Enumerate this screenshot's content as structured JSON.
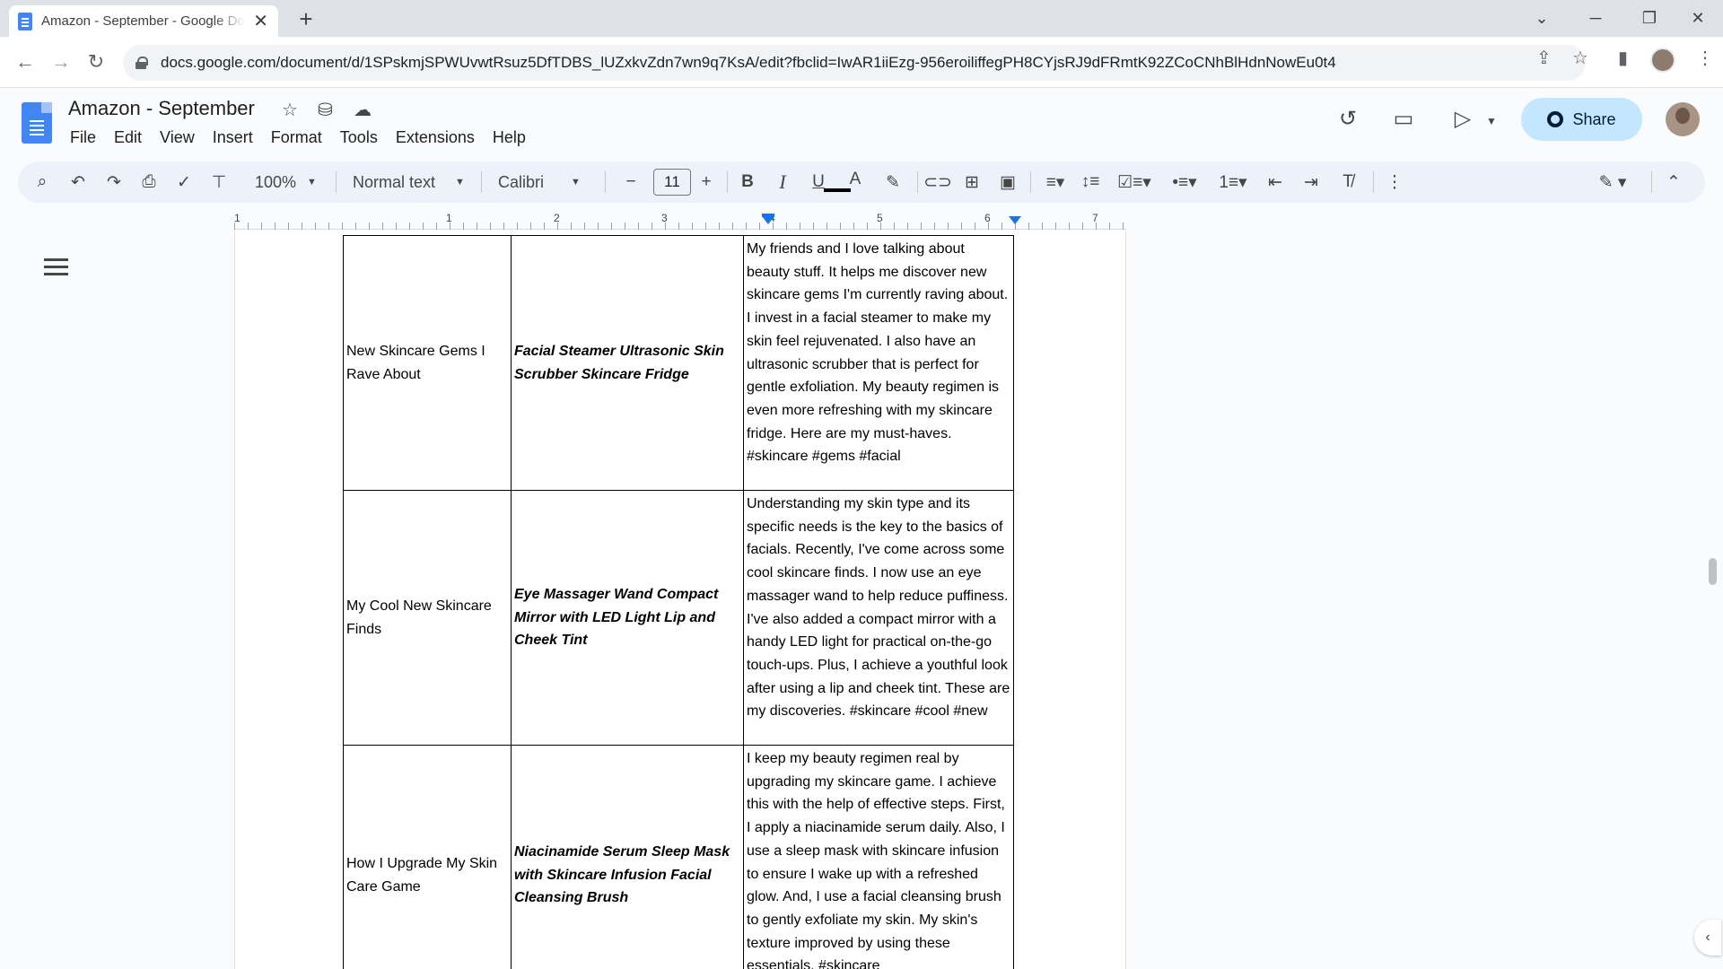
{
  "browser": {
    "tab_title": "Amazon - September - Google Docs",
    "tab_close": "✕",
    "new_tab": "+",
    "url": "docs.google.com/document/d/1SPskmjSPWUvwtRsuz5DfTDBS_lUZxkvZdn7wn9q7KsA/edit?fbclid=IwAR1iiEzg-956eroiliffegPH8CYjsRJ9dFRmtK92ZCoCNhBlHdnNowEu0t4"
  },
  "doc": {
    "title": "Amazon - September",
    "share_label": "Share",
    "menu": [
      "File",
      "Edit",
      "View",
      "Insert",
      "Format",
      "Tools",
      "Extensions",
      "Help"
    ]
  },
  "toolbar": {
    "zoom": "100%",
    "style": "Normal text",
    "font": "Calibri",
    "font_size": "11"
  },
  "ruler": {
    "labels": [
      "1",
      "1",
      "2",
      "3",
      "4",
      "5",
      "6",
      "7"
    ]
  },
  "table": {
    "rows": [
      {
        "topic": "New Skincare Gems I Rave About",
        "products": "Facial Steamer  Ultrasonic Skin Scrubber          Skincare Fridge",
        "caption": "My friends and I love talking about beauty stuff. It helps me discover new skincare gems I'm currently raving about. I invest in a facial steamer to make my skin feel rejuvenated. I also have an ultrasonic scrubber that is perfect for gentle exfoliation. My beauty regimen is even more refreshing with my skincare fridge. Here are my must-haves. #skincare #gems #facial"
      },
      {
        "topic": "My Cool New Skincare Finds",
        "products": "Eye Massager Wand      Compact Mirror with LED Light    Lip and Cheek Tint",
        "caption": "Understanding my skin type and its specific needs is the key to the basics of facials. Recently, I've come across some cool skincare finds. I now use an eye massager wand to help reduce puffiness. I've also added a compact mirror with a handy LED light for practical on-the-go touch-ups. Plus, I achieve a youthful look after using a lip and cheek tint. These are my discoveries. #skincare #cool #new"
      },
      {
        "topic": "How I Upgrade My Skin Care Game",
        "products": "Niacinamide Serum      Sleep Mask with Skincare Infusion Facial Cleansing Brush",
        "caption": "I keep my beauty regimen real by upgrading my skincare game. I achieve this with the help of effective steps. First, I apply a niacinamide serum daily. Also, I use a sleep mask with skincare infusion to ensure I wake up with a refreshed glow. And, I use a facial cleansing brush to gently exfoliate my skin. My skin's texture improved by using these essentials. #skincare"
      }
    ]
  },
  "icons": {
    "back": "back-arrow-icon",
    "forward": "forward-arrow-icon",
    "reload": "reload-icon",
    "history": "history-icon",
    "comments": "comment-icon",
    "meet": "video-camera-icon"
  }
}
